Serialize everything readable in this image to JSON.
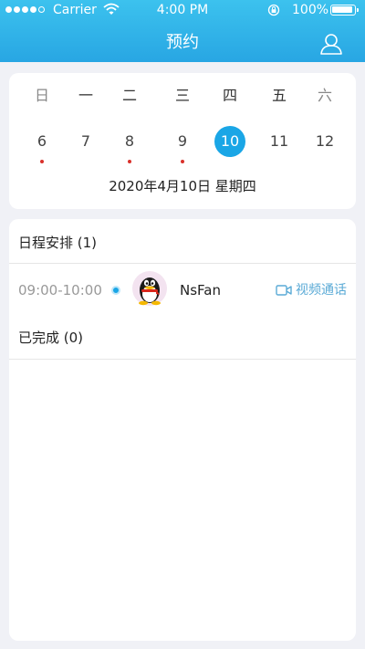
{
  "status_bar": {
    "carrier": "Carrier",
    "time": "4:00 PM",
    "battery": "100%"
  },
  "nav": {
    "title": "预约",
    "user_icon": "user-icon"
  },
  "calendar": {
    "weekdays": [
      "日",
      "一",
      "二",
      "三",
      "四",
      "五",
      "六"
    ],
    "dates": [
      "6",
      "7",
      "8",
      "9",
      "10",
      "11",
      "12"
    ],
    "selected_index": 4,
    "dates_with_events": [
      0,
      2,
      3
    ],
    "selected_label": "2020年4月10日   星期四"
  },
  "schedule": {
    "title": "日程安排 (1)",
    "items": [
      {
        "time": "09:00-10:00",
        "name": "NsFan",
        "action_label": "视频通话"
      }
    ]
  },
  "completed": {
    "title": "已完成 (0)"
  },
  "colors": {
    "header": "#28a6e3",
    "accent": "#1aa6e6",
    "event_dot": "#d9312b",
    "video_link": "#5aaad6"
  }
}
